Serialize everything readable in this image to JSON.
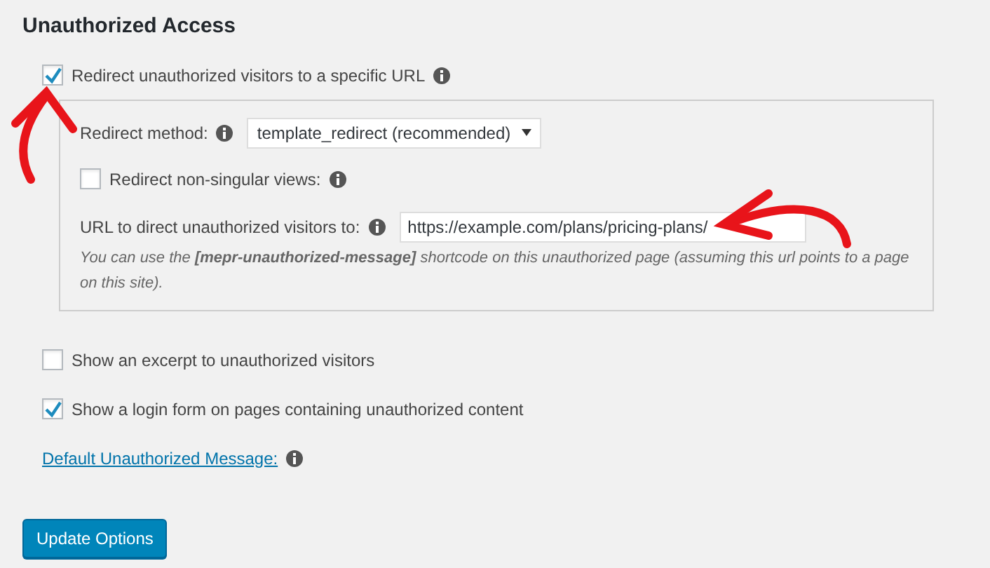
{
  "section_title": "Unauthorized Access",
  "redirect": {
    "label": "Redirect unauthorized visitors to a specific URL",
    "checked": true
  },
  "redirect_options": {
    "method_label": "Redirect method:",
    "method_value": "template_redirect (recommended)",
    "non_singular": {
      "label": "Redirect non-singular views:",
      "checked": false
    },
    "url_label": "URL to direct unauthorized visitors to:",
    "url_value": "https://example.com/plans/pricing-plans/",
    "help": "You can use the **[mepr-unauthorized-message]** shortcode on this unauthorized page (assuming this url points to a page on this site)."
  },
  "options": [
    {
      "label": "Show an excerpt to unauthorized visitors",
      "checked": false
    },
    {
      "label": "Show a login form on pages containing unauthorized content",
      "checked": true
    }
  ],
  "message_link": "Default Unauthorized Message:",
  "submit": "Update Options"
}
